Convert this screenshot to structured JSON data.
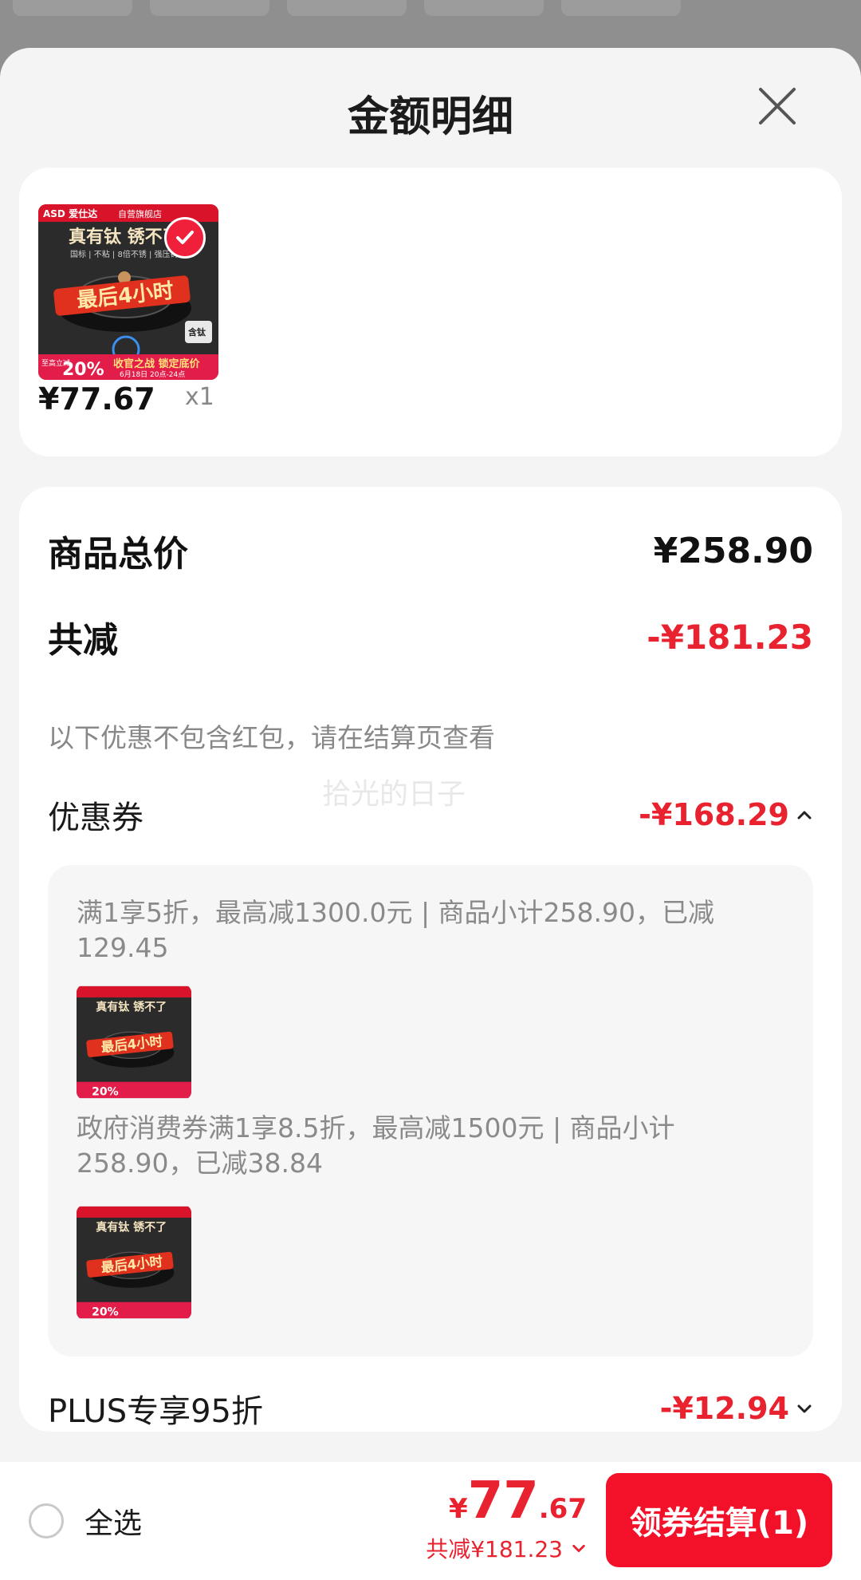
{
  "sheet": {
    "title": "金额明细"
  },
  "product": {
    "price": "¥77.67",
    "qty": "x1",
    "thumb_text": {
      "brand": "ASD 爱仕达",
      "store": "自营旗舰店",
      "headline": "真有钛 锈不了",
      "sub": "国标 | 不粘 | 8倍不锈 | 强压铸",
      "banner": "最后4小时",
      "badge_left": "至高立减",
      "badge_pct": "20%",
      "promo": "收官之战 锁定底价",
      "date": "6月18日 20点-24点",
      "tag": "含钛"
    }
  },
  "summary": {
    "total_label": "商品总价",
    "total_value": "¥258.90",
    "reduce_label": "共减",
    "reduce_value": "-¥181.23",
    "note": "以下优惠不包含红包，请在结算页查看",
    "watermark": "拾光的日子",
    "coupon_label": "优惠券",
    "coupon_value": "-¥168.29",
    "coupons": [
      {
        "desc": "满1享5折，最高减1300.0元 | 商品小计258.90，已减129.45"
      },
      {
        "desc": "政府消费券满1享8.5折，最高减1500元 | 商品小计258.90，已减38.84"
      }
    ],
    "plus_label": "PLUS专享95折",
    "plus_value": "-¥12.94"
  },
  "bottom": {
    "select_all": "全选",
    "currency": "¥",
    "price_int": "77",
    "price_dec": ".67",
    "saved": "共减¥181.23",
    "checkout": "领券结算(1)"
  },
  "colors": {
    "accent": "#e8222e",
    "button": "#f3112a",
    "sheet_bg": "#f4f4f4"
  },
  "icons": [
    "close-icon",
    "check-icon",
    "chevron-up-icon",
    "chevron-down-icon",
    "radio-icon"
  ]
}
